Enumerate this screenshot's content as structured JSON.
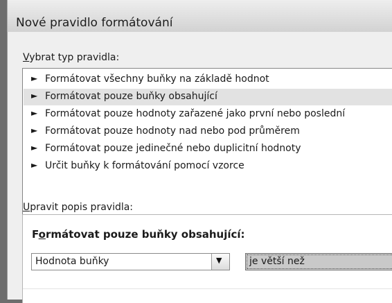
{
  "window": {
    "title": "Nové pravidlo formátování"
  },
  "rule_type": {
    "label_accel": "V",
    "label_rest": "ybrat typ pravidla:",
    "items": [
      {
        "label": "Formátovat všechny buňky na základě hodnot",
        "selected": false
      },
      {
        "label": "Formátovat pouze buňky obsahující",
        "selected": true
      },
      {
        "label": "Formátovat pouze hodnoty zařazené jako první nebo poslední",
        "selected": false
      },
      {
        "label": "Formátovat pouze hodnoty nad nebo pod průměrem",
        "selected": false
      },
      {
        "label": "Formátovat pouze jedinečné nebo duplicitní hodnoty",
        "selected": false
      },
      {
        "label": "Určit buňky k formátování pomocí vzorce",
        "selected": false
      }
    ],
    "arrow_glyph": "►"
  },
  "edit_rule": {
    "label_accel": "U",
    "label_rest": "pravit popis pravidla:",
    "heading_pre": "F",
    "heading_accel": "o",
    "heading_post": "rmátovat pouze buňky obsahující:",
    "condition_type": {
      "value": "Hodnota buňky",
      "dropdown_glyph": "▼"
    },
    "operator": {
      "value": "je větší než"
    }
  },
  "colors": {
    "selection": "#e2e2e2",
    "title_bar": "#dedede"
  }
}
